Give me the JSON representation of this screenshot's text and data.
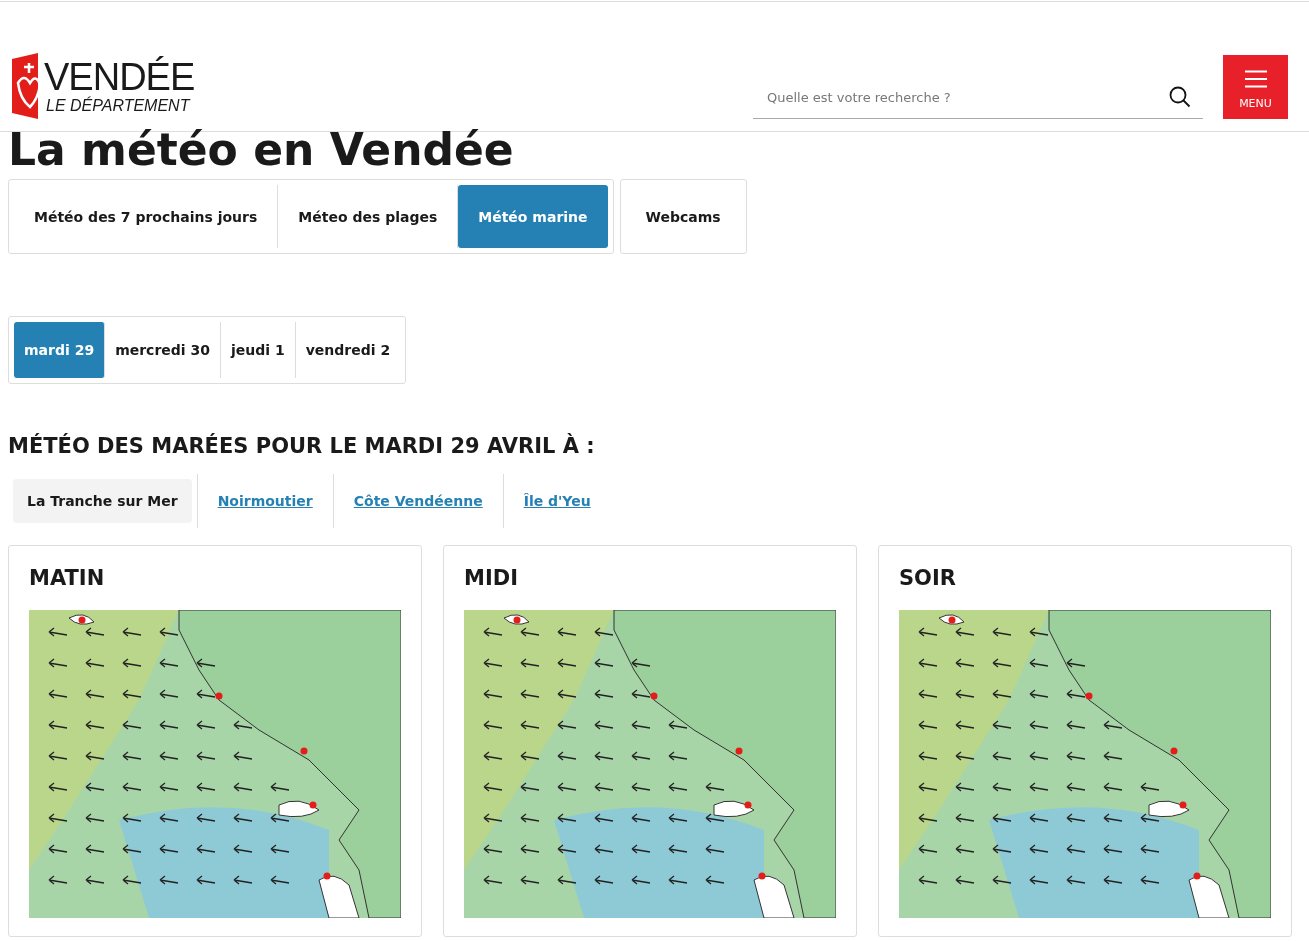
{
  "header": {
    "logo_title": "VENDÉE",
    "logo_subtitle": "LE DÉPARTEMENT",
    "search": {
      "placeholder": "Quelle est votre recherche ?"
    },
    "menu_label": "MENU"
  },
  "page_title": "La météo en Vendée",
  "tab_groups": [
    [
      {
        "label": "Météo des 7 prochains jours",
        "selected": false
      },
      {
        "label": "Méteo des plages",
        "selected": false
      },
      {
        "label": "Météo marine",
        "selected": true
      }
    ],
    [
      {
        "label": "Webcams",
        "selected": false
      }
    ]
  ],
  "days": [
    {
      "label": "mardi 29",
      "selected": true
    },
    {
      "label": "mercredi 30",
      "selected": false
    },
    {
      "label": "jeudi 1",
      "selected": false
    },
    {
      "label": "vendredi 2",
      "selected": false
    }
  ],
  "section_title": "MÉTÉO DES MARÉES POUR LE MARDI 29 AVRIL À :",
  "locations": [
    {
      "label": "La Tranche sur Mer",
      "selected": true
    },
    {
      "label": "Noirmoutier",
      "selected": false
    },
    {
      "label": "Côte Vendéenne",
      "selected": false
    },
    {
      "label": "Île d'Yeu",
      "selected": false
    }
  ],
  "periods": [
    {
      "title": "MATIN"
    },
    {
      "title": "MIDI"
    },
    {
      "title": "SOIR"
    }
  ]
}
